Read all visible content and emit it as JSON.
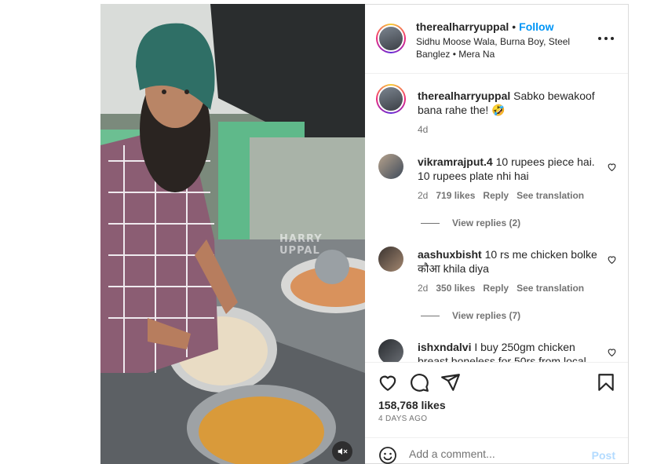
{
  "post": {
    "username": "therealharryuppal",
    "separator": "•",
    "follow_label": "Follow",
    "audio": "Sidhu Moose Wala, Burna Boy, Steel Banglez • Mera Na",
    "more_icon": "more-horizontal-icon",
    "watermark": "HARRY UPPAL",
    "mute_icon": "speaker-muted-icon"
  },
  "caption": {
    "username": "therealharryuppal",
    "text": "Sabko bewakoof bana rahe the! 🤣",
    "time": "4d"
  },
  "comments": [
    {
      "username": "vikramrajput.4",
      "text": "10 rupees piece hai. 10 rupees plate nhi hai",
      "time": "2d",
      "likes": "719 likes",
      "reply_label": "Reply",
      "translate_label": "See translation",
      "view_replies": "View replies (2)"
    },
    {
      "username": "aashuxbisht",
      "text": "10 rs me chicken bolke कौआ khila diya",
      "time": "2d",
      "likes": "350 likes",
      "reply_label": "Reply",
      "translate_label": "See translation",
      "view_replies": "View replies (7)"
    },
    {
      "username": "ishxndalvi",
      "text": "I buy 250gm chicken breast boneless for 50rs from local"
    }
  ],
  "actions": {
    "icons": [
      "heart-icon",
      "comment-icon",
      "share-icon",
      "bookmark-icon"
    ],
    "likes": "158,768 likes",
    "time_ago": "4 DAYS AGO"
  },
  "composer": {
    "emoji_icon": "emoji-icon",
    "placeholder": "Add a comment...",
    "post_label": "Post"
  }
}
